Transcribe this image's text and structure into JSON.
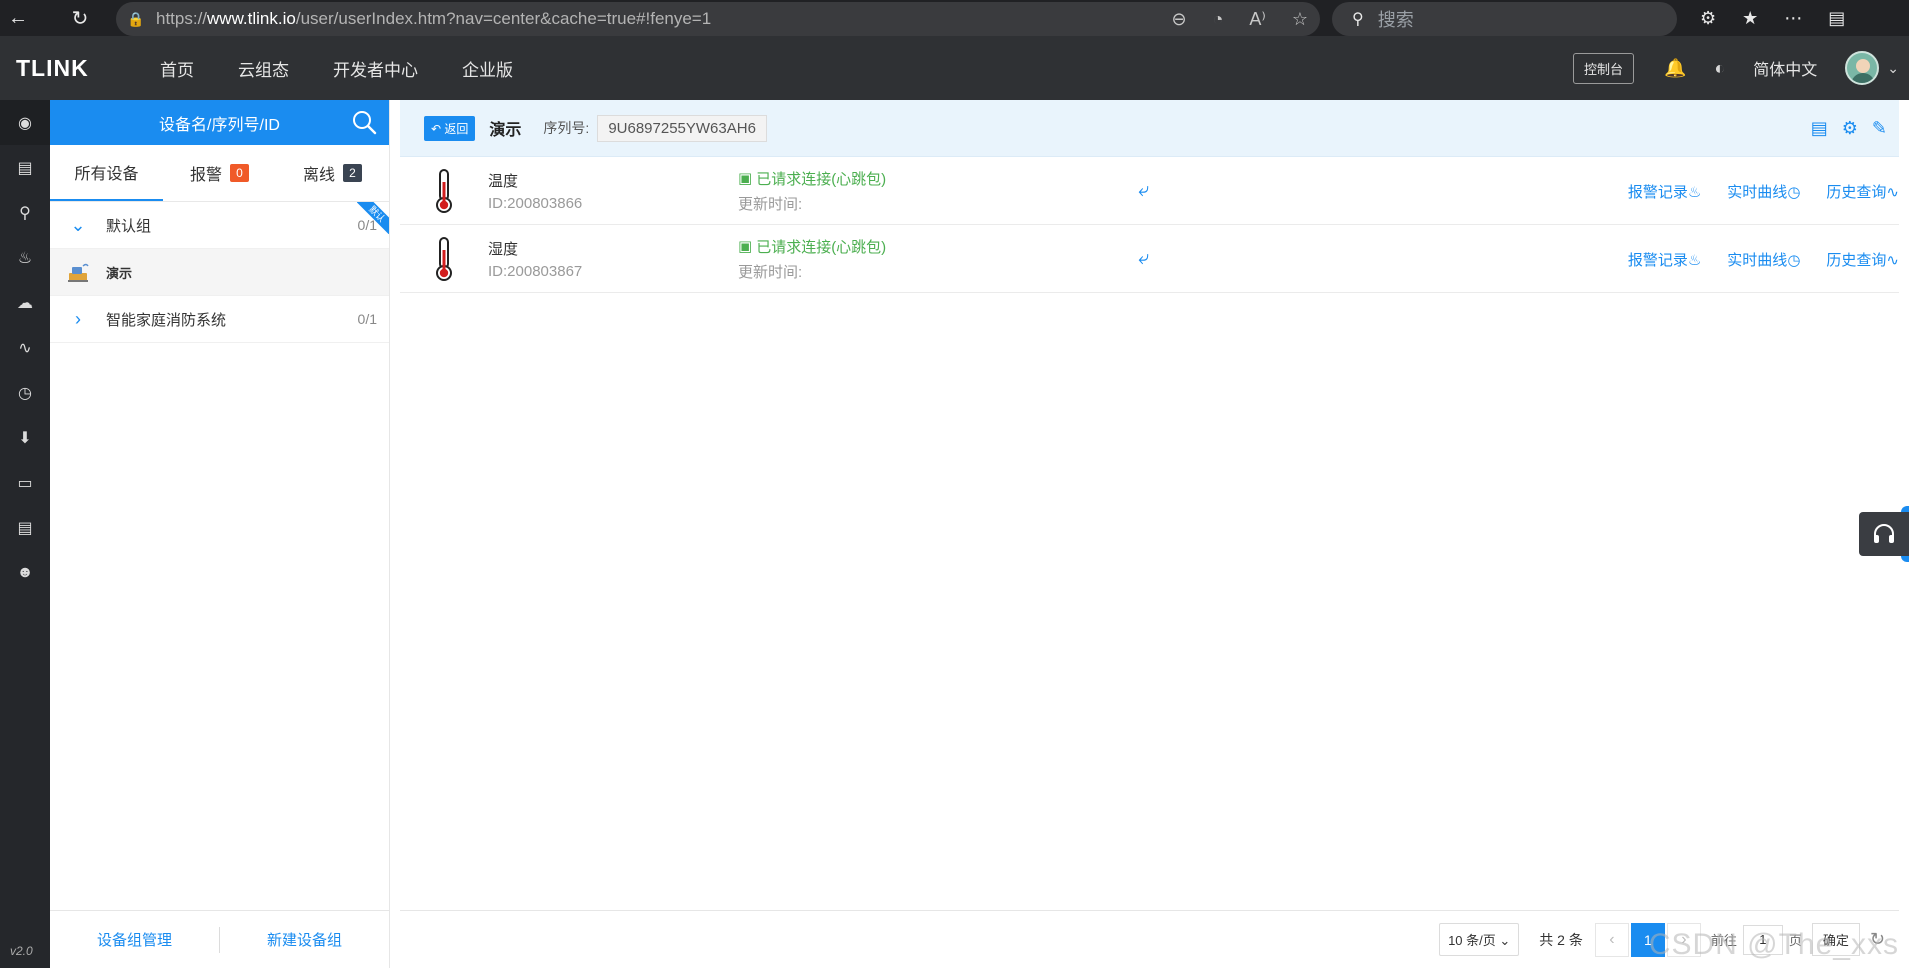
{
  "browser": {
    "url_prefix": "https://",
    "url_host": "www.tlink.io",
    "url_path": "/user/userIndex.htm?nav=center&cache=true#!fenye=1",
    "search_placeholder": "搜索"
  },
  "header": {
    "logo": "TLINK",
    "nav": [
      "首页",
      "云组态",
      "开发者中心",
      "企业版"
    ],
    "console_label": "控制台",
    "language": "简体中文"
  },
  "rail": {
    "icons": [
      "target-icon",
      "screen-icon",
      "location-icon",
      "bell-icon",
      "cloud-icon",
      "nodes-icon",
      "clock-icon",
      "download-icon",
      "monitor-icon",
      "card-icon",
      "user-icon"
    ],
    "version": "v2.0"
  },
  "tree": {
    "search_label": "设备名/序列号/ID",
    "tabs": [
      {
        "label": "所有设备",
        "badge": ""
      },
      {
        "label": "报警",
        "badge": "0"
      },
      {
        "label": "离线",
        "badge": "2"
      }
    ],
    "groups": [
      {
        "name": "默认组",
        "count": "0/1",
        "ribbon": "默认",
        "expanded": true
      },
      {
        "name": "智能家庭消防系统",
        "count": "0/1",
        "expanded": false
      }
    ],
    "device": {
      "name": "演示"
    },
    "footer": {
      "manage": "设备组管理",
      "create": "新建设备组"
    }
  },
  "main": {
    "back_label": "返回",
    "title": "演示",
    "serial_label": "序列号:",
    "serial_value": "9U6897255YW63AH6",
    "sensors": [
      {
        "name": "温度",
        "id": "ID:200803866",
        "status": "已请求连接(心跳包)",
        "update": "更新时间:"
      },
      {
        "name": "湿度",
        "id": "ID:200803867",
        "status": "已请求连接(心跳包)",
        "update": "更新时间:"
      }
    ],
    "links": {
      "alarm": "报警记录",
      "realtime": "实时曲线",
      "history": "历史查询"
    },
    "pager": {
      "page_size": "10 条/页",
      "total": "共 2 条",
      "current": "1",
      "goto": "前往",
      "page_input": "1",
      "page_unit": "页",
      "confirm": "确定"
    },
    "watermark": "CSDN @The_xxs"
  },
  "colors": {
    "accent": "#1a8cf0",
    "online": "#4caf50",
    "alarm_badge": "#f05a28"
  }
}
